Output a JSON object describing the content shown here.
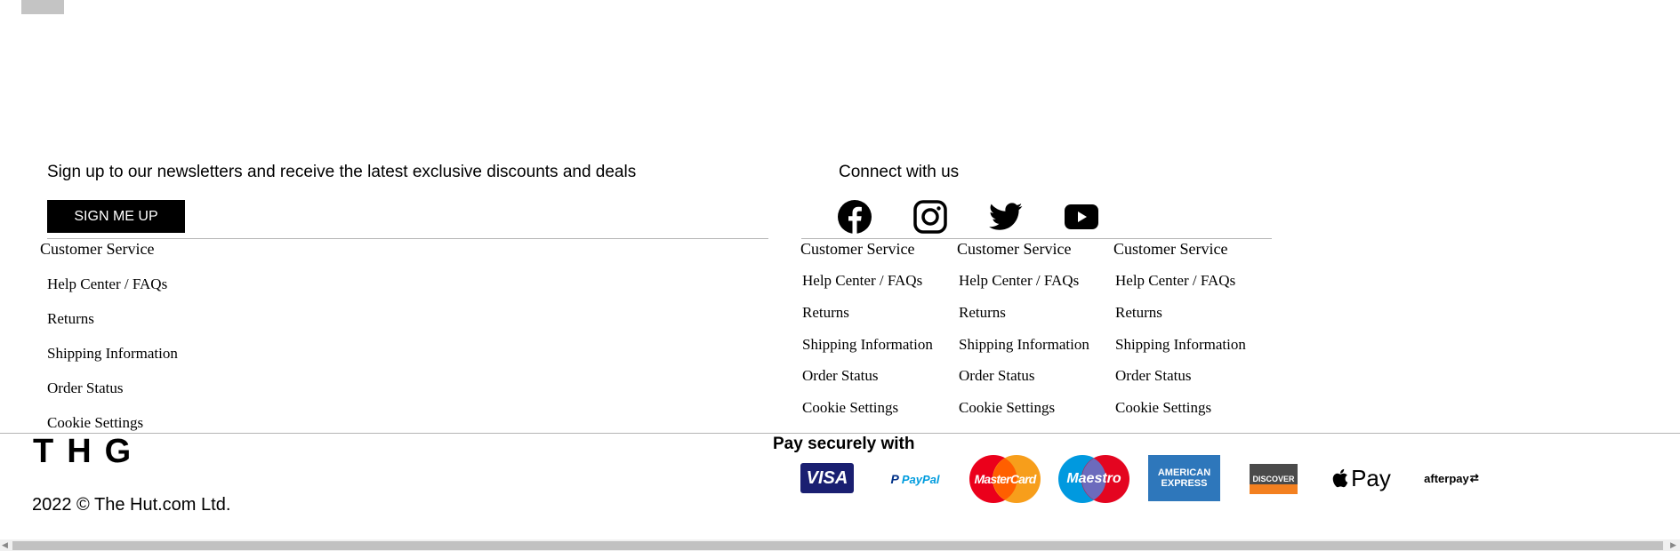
{
  "newsletter": {
    "text": "Sign up to our newsletters and receive the latest exclusive discounts and deals",
    "button": "SIGN ME UP"
  },
  "connect": {
    "title": "Connect with us",
    "icons": [
      "facebook-icon",
      "instagram-icon",
      "twitter-icon",
      "youtube-icon"
    ]
  },
  "columns": [
    {
      "title": "Customer Service",
      "links": [
        "Help Center / FAQs",
        "Returns",
        "Shipping Information",
        "Order Status",
        "Cookie Settings"
      ]
    },
    {
      "title": "Customer Service",
      "links": [
        "Help Center / FAQs",
        "Returns",
        "Shipping Information",
        "Order Status",
        "Cookie Settings"
      ]
    },
    {
      "title": "Customer Service",
      "links": [
        "Help Center / FAQs",
        "Returns",
        "Shipping Information",
        "Order Status",
        "Cookie Settings"
      ]
    },
    {
      "title": "Customer Service",
      "links": [
        "Help Center / FAQs",
        "Returns",
        "Shipping Information",
        "Order Status",
        "Cookie Settings"
      ]
    }
  ],
  "bottom": {
    "brand": "THG",
    "copyright": "2022 © The Hut.com Ltd.",
    "pay_title": "Pay securely with",
    "payment_methods": [
      {
        "name": "visa",
        "label": "VISA"
      },
      {
        "name": "paypal",
        "label": "PayPal"
      },
      {
        "name": "mastercard",
        "label": "MasterCard"
      },
      {
        "name": "maestro",
        "label": "Maestro"
      },
      {
        "name": "amex",
        "label": "AMERICAN EXPRESS"
      },
      {
        "name": "discover",
        "label": "DISCOVER"
      },
      {
        "name": "applepay",
        "label": "Pay"
      },
      {
        "name": "afterpay",
        "label": "afterpay"
      }
    ]
  },
  "colors": {
    "button_bg": "#000000",
    "rule": "#b5b5b5",
    "visa": "#1a1f71",
    "paypal": "#003087",
    "mastercard_red": "#eb001b",
    "mastercard_orange": "#f79e1b",
    "maestro_blue": "#0099df",
    "amex": "#2e77bb",
    "discover_orange": "#f38020"
  }
}
